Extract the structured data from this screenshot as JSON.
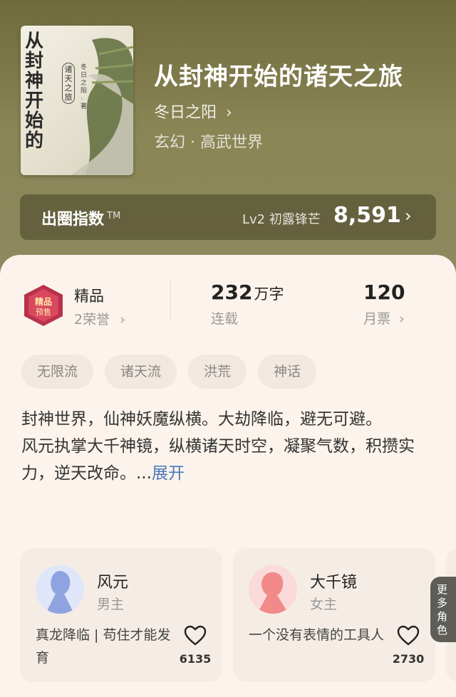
{
  "cover": {
    "title_vertical": "从封神开始的",
    "subtitle_vertical": "诸天之旅",
    "author_vertical": "冬日之阳 · 著"
  },
  "book": {
    "title": "从封神开始的诸天之旅",
    "author": "冬日之阳",
    "genre": "玄幻 · 高武世界"
  },
  "chuquan": {
    "label": "出圈指数",
    "tm": "TM",
    "level": "Lv2 初露锋芒",
    "score": "8,591",
    "arrow": "›"
  },
  "honor": {
    "name": "精品",
    "count_label": "2荣誉",
    "badge_text": "精品预售"
  },
  "words": {
    "number": "232",
    "unit": "万字",
    "status": "连载"
  },
  "monthly": {
    "number": "120",
    "label": "月票"
  },
  "tags": [
    "无限流",
    "诸天流",
    "洪荒",
    "神话"
  ],
  "description": {
    "line1": "封神世界，仙神妖魔纵横。大劫降临，避无可避。",
    "line2": "风元执掌大千神镜，纵横诸天时空，凝聚气数，积攒实力，逆天改命。...",
    "expand": "展开"
  },
  "roles": [
    {
      "name": "风元",
      "tag": "男主",
      "desc": "真龙降临 | 苟住才能发育",
      "likes": "6135",
      "avatar_color": "#8fa3e0"
    },
    {
      "name": "大千镜",
      "tag": "女主",
      "desc": "一个没有表情的工具人",
      "likes": "2730",
      "avatar_color": "#f28a8a"
    }
  ],
  "more_roles": "更多角色",
  "colors": {
    "header_bg": "#7d7a4d",
    "panel_bg": "#fbf3ec",
    "link": "#4a78b8"
  }
}
